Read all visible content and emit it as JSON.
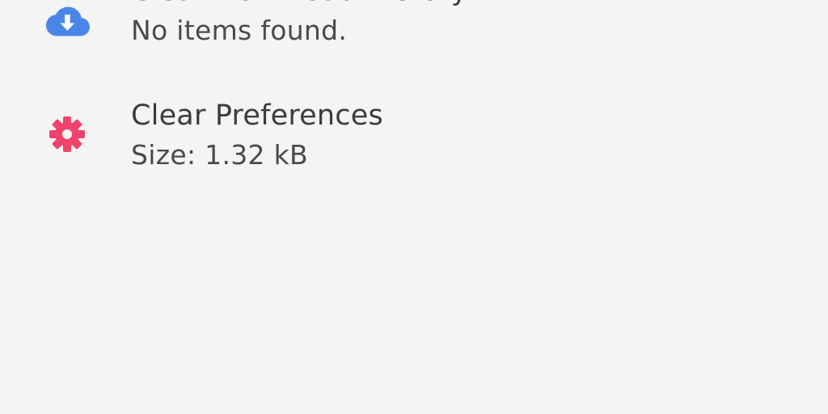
{
  "items": [
    {
      "title": "Clear Download History",
      "subtitle": "No items found.",
      "icon": "cloud-download-icon",
      "icon_color": "#4a86e8"
    },
    {
      "title": "Clear Preferences",
      "subtitle": "Size: 1.32 kB",
      "icon": "gear-icon",
      "icon_color": "#f0426b"
    }
  ],
  "colors": {
    "background": "#f4f4f4",
    "title_text": "#3c3c3c",
    "subtitle_text": "#4a4a4a"
  }
}
